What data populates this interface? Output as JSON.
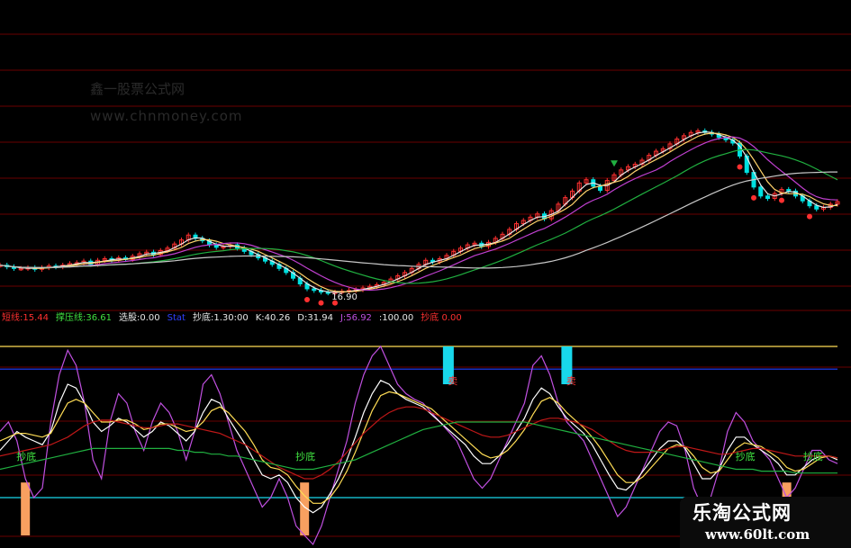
{
  "watermark": {
    "line1": "鑫一股票公式网",
    "line2": "www.chnmoney.com"
  },
  "brand": {
    "name": "乐淘公式网",
    "url": "www.60lt.com"
  },
  "colors": {
    "background": "#000000",
    "grid": "#6a0000",
    "candle_up": "#ff3030",
    "candle_down": "#00e0e0",
    "ma_white": "#e8e8e8",
    "ma_yellow": "#ffd36b",
    "ma_magenta": "#c040d0",
    "ma_green": "#20b040",
    "ma_silver": "#c8c8c8",
    "ind_white": "#ffffff",
    "ind_yellow": "#ffdd55",
    "ind_purple": "#c050e0",
    "ind_red": "#c01818",
    "ind_green": "#20b040",
    "ind_blue": "#2040ff",
    "bar_orange": "#f8a060",
    "bar_cyan": "#18d8ec",
    "label_red": "#ff3030",
    "label_green": "#40e040"
  },
  "chart_data": [
    {
      "type": "candlestick",
      "title": "",
      "annotation_low": "16.90",
      "grid": true,
      "price_series": [
        49,
        47,
        45,
        45,
        46,
        44,
        46,
        48,
        47,
        49,
        51,
        52,
        54,
        50,
        55,
        57,
        55,
        58,
        56,
        60,
        63,
        65,
        62,
        67,
        70,
        75,
        80,
        86,
        82,
        79,
        74,
        71,
        72,
        74,
        70,
        66,
        62,
        58,
        54,
        50,
        45,
        40,
        33,
        26,
        20,
        18,
        16,
        15,
        16,
        17,
        18,
        19,
        21,
        23,
        25,
        28,
        32,
        36,
        40,
        45,
        50,
        55,
        53,
        57,
        61,
        66,
        70,
        74,
        76,
        72,
        77,
        82,
        87,
        93,
        100,
        104,
        108,
        112,
        106,
        116,
        124,
        132,
        140,
        150,
        154,
        146,
        141,
        153,
        160,
        166,
        170,
        173,
        178,
        184,
        189,
        192,
        198,
        204,
        208,
        212,
        214,
        212,
        210,
        206,
        203,
        199,
        183,
        163,
        145,
        134,
        131,
        137,
        142,
        140,
        134,
        128,
        122,
        118,
        120,
        124,
        127
      ],
      "signals": {
        "up_arrows_green": [
          88
        ],
        "down_markers_red": [
          44,
          46,
          48,
          106,
          108,
          112,
          116
        ]
      }
    },
    {
      "type": "line",
      "title": "",
      "legend": [
        {
          "label": "短线:15.44",
          "color": "#ff3030"
        },
        {
          "label": "撑压线:36.61",
          "color": "#40e040"
        },
        {
          "label": "选股:0.00",
          "color": "#e8e8e8"
        },
        {
          "label": "Stat",
          "color": "#3040ff"
        },
        {
          "label": "抄底:1.30:00",
          "color": "#e8e8e8"
        },
        {
          "label": "K:40.26",
          "color": "#e8e8e8"
        },
        {
          "label": "D:31.94",
          "color": "#e8e8e8"
        },
        {
          "label": "J:56.92",
          "color": "#c050e0"
        },
        {
          "label": ":100.00",
          "color": "#e8e8e8"
        },
        {
          "label": "抄底 0.00",
          "color": "#ff3030"
        }
      ],
      "ylim": [
        0,
        100
      ],
      "reference_levels": [
        {
          "name": "yellow_band",
          "value": 100,
          "color": "#ffdd55"
        },
        {
          "name": "blue_line",
          "value": 88,
          "color": "#2040ff"
        },
        {
          "name": "cyan_base",
          "value": 20,
          "color": "#18d8ec"
        }
      ],
      "series": [
        {
          "color": "#c050e0",
          "values": [
            55,
            60,
            50,
            30,
            20,
            25,
            60,
            85,
            98,
            90,
            70,
            40,
            30,
            60,
            75,
            70,
            55,
            45,
            60,
            70,
            65,
            55,
            40,
            55,
            80,
            85,
            75,
            60,
            45,
            35,
            25,
            15,
            20,
            30,
            20,
            5,
            0,
            -5,
            5,
            20,
            35,
            50,
            70,
            85,
            95,
            100,
            90,
            80,
            75,
            72,
            70,
            65,
            60,
            55,
            50,
            40,
            30,
            25,
            30,
            40,
            50,
            60,
            70,
            90,
            95,
            85,
            70,
            60,
            55,
            50,
            40,
            30,
            20,
            10,
            15,
            25,
            35,
            45,
            55,
            60,
            58,
            45,
            25,
            15,
            20,
            35,
            55,
            65,
            60,
            50,
            45,
            40,
            30,
            20,
            25,
            35,
            45,
            45,
            40,
            38
          ]
        },
        {
          "color": "#ffffff",
          "values": [
            45,
            50,
            55,
            52,
            50,
            48,
            55,
            70,
            80,
            78,
            70,
            60,
            55,
            58,
            62,
            60,
            56,
            52,
            55,
            60,
            58,
            54,
            50,
            55,
            65,
            72,
            70,
            62,
            55,
            48,
            40,
            32,
            30,
            32,
            28,
            20,
            15,
            12,
            15,
            22,
            30,
            40,
            52,
            65,
            75,
            82,
            80,
            75,
            72,
            70,
            68,
            64,
            60,
            56,
            52,
            48,
            42,
            38,
            38,
            42,
            48,
            55,
            62,
            72,
            78,
            75,
            68,
            62,
            58,
            54,
            48,
            40,
            32,
            25,
            24,
            28,
            34,
            40,
            46,
            50,
            50,
            46,
            38,
            30,
            30,
            35,
            45,
            52,
            52,
            48,
            45,
            42,
            38,
            32,
            32,
            36,
            40,
            42,
            42,
            40
          ]
        },
        {
          "color": "#ffdd55",
          "values": [
            50,
            52,
            54,
            54,
            53,
            52,
            54,
            62,
            70,
            72,
            70,
            65,
            60,
            60,
            61,
            61,
            59,
            56,
            57,
            59,
            59,
            57,
            55,
            56,
            60,
            66,
            68,
            65,
            60,
            55,
            48,
            40,
            36,
            35,
            32,
            26,
            21,
            17,
            17,
            20,
            26,
            34,
            44,
            55,
            66,
            74,
            76,
            75,
            73,
            71,
            69,
            67,
            63,
            59,
            55,
            51,
            47,
            43,
            41,
            42,
            45,
            50,
            56,
            64,
            71,
            73,
            70,
            65,
            61,
            57,
            52,
            46,
            39,
            32,
            28,
            28,
            31,
            36,
            41,
            46,
            48,
            47,
            42,
            36,
            33,
            34,
            40,
            46,
            49,
            48,
            47,
            44,
            41,
            36,
            34,
            35,
            38,
            41,
            42,
            41
          ]
        },
        {
          "color": "#c01818",
          "values": [
            42,
            43,
            44,
            45,
            46,
            47,
            48,
            50,
            52,
            55,
            58,
            60,
            61,
            61,
            60,
            59,
            58,
            57,
            57,
            58,
            59,
            59,
            58,
            57,
            56,
            55,
            54,
            52,
            50,
            48,
            45,
            42,
            39,
            36,
            34,
            32,
            30,
            30,
            32,
            35,
            39,
            44,
            49,
            54,
            58,
            62,
            65,
            67,
            68,
            68,
            67,
            65,
            63,
            61,
            59,
            57,
            55,
            53,
            52,
            52,
            53,
            55,
            57,
            59,
            61,
            62,
            62,
            61,
            60,
            58,
            56,
            53,
            50,
            47,
            45,
            44,
            44,
            44,
            45,
            46,
            47,
            47,
            46,
            45,
            44,
            43,
            43,
            44,
            45,
            46,
            46,
            45,
            44,
            43,
            42,
            42,
            42,
            42,
            42,
            41
          ]
        },
        {
          "color": "#20b040",
          "values": [
            35,
            36,
            37,
            38,
            39,
            40,
            41,
            42,
            43,
            44,
            45,
            46,
            46,
            46,
            46,
            46,
            46,
            46,
            46,
            46,
            46,
            45,
            45,
            44,
            44,
            43,
            43,
            42,
            42,
            41,
            40,
            39,
            38,
            37,
            36,
            35,
            35,
            35,
            36,
            37,
            38,
            39,
            40,
            42,
            44,
            46,
            48,
            50,
            52,
            54,
            56,
            57,
            58,
            59,
            60,
            60,
            60,
            60,
            60,
            60,
            60,
            60,
            60,
            59,
            58,
            57,
            56,
            55,
            54,
            53,
            52,
            51,
            50,
            49,
            48,
            47,
            46,
            45,
            44,
            43,
            42,
            41,
            40,
            39,
            38,
            37,
            36,
            35,
            35,
            35,
            34,
            34,
            34,
            34,
            33,
            33,
            33,
            33,
            33,
            33
          ]
        }
      ],
      "bars_orange": [
        3,
        36,
        93
      ],
      "bars_cyan": [
        53,
        67
      ],
      "text_labels": [
        {
          "text": "抄底",
          "color": "#40e040",
          "x_index": 3
        },
        {
          "text": "抄底",
          "color": "#40e040",
          "x_index": 36
        },
        {
          "text": "抄底",
          "color": "#40e040",
          "x_index": 88
        },
        {
          "text": "抄底",
          "color": "#40e040",
          "x_index": 96
        },
        {
          "text": "卖",
          "color": "#ff3030",
          "x_index": 54
        },
        {
          "text": "卖",
          "color": "#ff3030",
          "x_index": 68
        }
      ]
    }
  ]
}
